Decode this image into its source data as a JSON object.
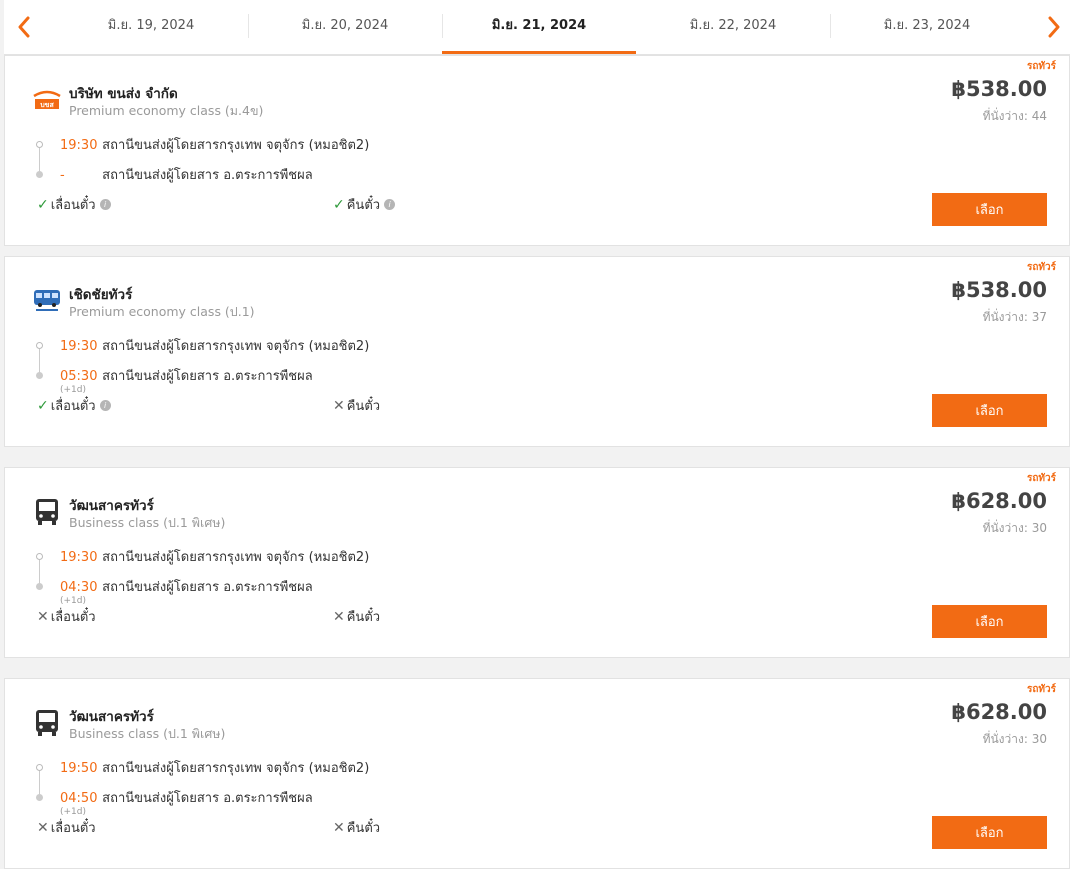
{
  "dates": {
    "prev_icon": "chevron-left-icon",
    "next_icon": "chevron-right-icon",
    "tabs": [
      {
        "label": "มิ.ย. 19, 2024"
      },
      {
        "label": "มิ.ย. 20, 2024"
      },
      {
        "label": "มิ.ย. 21, 2024",
        "active": true
      },
      {
        "label": "มิ.ย. 22, 2024"
      },
      {
        "label": "มิ.ย. 23, 2024"
      }
    ]
  },
  "colors": {
    "accent": "#f26b14",
    "ok": "#2e9a3a"
  },
  "trips": [
    {
      "tag": "รถทัวร์",
      "logo": "bks-logo",
      "operator": "บริษัท ขนส่ง จำกัด",
      "class": "Premium economy class (ม.4ข)",
      "price": "฿538.00",
      "seats": "ที่นั่งว่าง: 44",
      "dep_time": "19:30",
      "dep_station": "สถานีขนส่งผู้โดยสารกรุงเทพ จตุจักร (หมอชิต2)",
      "arr_time": "-",
      "arr_station": "สถานีขนส่งผู้โดยสาร อ.ตระการพืชผล",
      "plus_day": "",
      "feature1": {
        "mark": "✓",
        "ok": true,
        "label": "เลื่อนตั๋ว",
        "info": true
      },
      "feature2": {
        "mark": "✓",
        "ok": true,
        "label": "คืนตั๋ว",
        "info": true
      },
      "button": "เลือก"
    },
    {
      "tag": "รถทัวร์",
      "logo": "cherdchai-logo",
      "operator": "เชิดชัยทัวร์",
      "class": "Premium economy class (ป.1)",
      "price": "฿538.00",
      "seats": "ที่นั่งว่าง: 37",
      "dep_time": "19:30",
      "dep_station": "สถานีขนส่งผู้โดยสารกรุงเทพ จตุจักร (หมอชิต2)",
      "arr_time": "05:30",
      "arr_station": "สถานีขนส่งผู้โดยสาร อ.ตระการพืชผล",
      "plus_day": "(+1d)",
      "feature1": {
        "mark": "✓",
        "ok": true,
        "label": "เลื่อนตั๋ว",
        "info": true
      },
      "feature2": {
        "mark": "✕",
        "ok": false,
        "label": "คืนตั๋ว",
        "info": false
      },
      "button": "เลือก"
    },
    {
      "tag": "รถทัวร์",
      "logo": "bus-icon",
      "operator": "วัฒนสาครทัวร์",
      "class": "Business class (ป.1 พิเศษ)",
      "price": "฿628.00",
      "seats": "ที่นั่งว่าง: 30",
      "dep_time": "19:30",
      "dep_station": "สถานีขนส่งผู้โดยสารกรุงเทพ จตุจักร (หมอชิต2)",
      "arr_time": "04:30",
      "arr_station": "สถานีขนส่งผู้โดยสาร อ.ตระการพืชผล",
      "plus_day": "(+1d)",
      "feature1": {
        "mark": "✕",
        "ok": false,
        "label": "เลื่อนตั๋ว",
        "info": false
      },
      "feature2": {
        "mark": "✕",
        "ok": false,
        "label": "คืนตั๋ว",
        "info": false
      },
      "button": "เลือก"
    },
    {
      "tag": "รถทัวร์",
      "logo": "bus-icon",
      "operator": "วัฒนสาครทัวร์",
      "class": "Business class (ป.1 พิเศษ)",
      "price": "฿628.00",
      "seats": "ที่นั่งว่าง: 30",
      "dep_time": "19:50",
      "dep_station": "สถานีขนส่งผู้โดยสารกรุงเทพ จตุจักร (หมอชิต2)",
      "arr_time": "04:50",
      "arr_station": "สถานีขนส่งผู้โดยสาร อ.ตระการพืชผล",
      "plus_day": "(+1d)",
      "feature1": {
        "mark": "✕",
        "ok": false,
        "label": "เลื่อนตั๋ว",
        "info": false
      },
      "feature2": {
        "mark": "✕",
        "ok": false,
        "label": "คืนตั๋ว",
        "info": false
      },
      "button": "เลือก"
    }
  ]
}
